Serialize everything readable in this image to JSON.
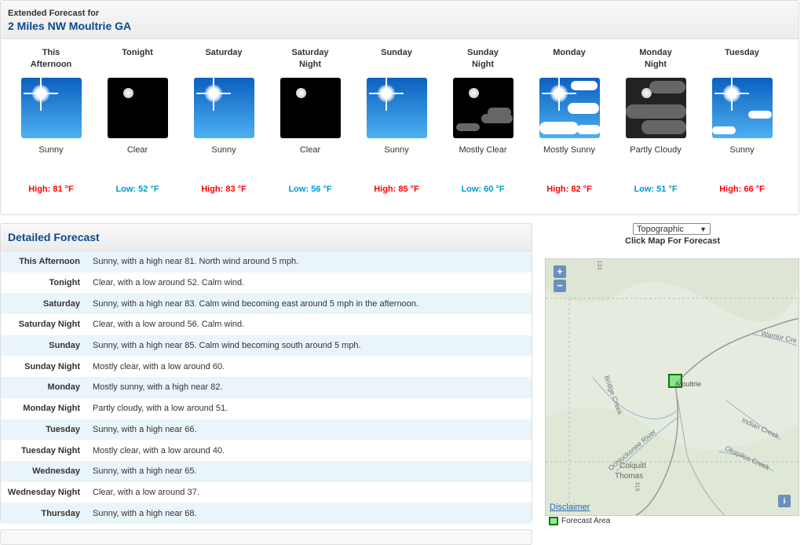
{
  "extended": {
    "label": "Extended Forecast for",
    "location": "2 Miles NW Moultrie GA",
    "periods": [
      {
        "name1": "This",
        "name2": "Afternoon",
        "icon": "sunny",
        "desc": "Sunny",
        "temp": "High: 81 °F",
        "kind": "hi"
      },
      {
        "name1": "Tonight",
        "name2": "",
        "icon": "clear-night",
        "desc": "Clear",
        "temp": "Low: 52 °F",
        "kind": "lo"
      },
      {
        "name1": "Saturday",
        "name2": "",
        "icon": "sunny",
        "desc": "Sunny",
        "temp": "High: 83 °F",
        "kind": "hi"
      },
      {
        "name1": "Saturday",
        "name2": "Night",
        "icon": "clear-night",
        "desc": "Clear",
        "temp": "Low: 56 °F",
        "kind": "lo"
      },
      {
        "name1": "Sunday",
        "name2": "",
        "icon": "sunny",
        "desc": "Sunny",
        "temp": "High: 85 °F",
        "kind": "hi"
      },
      {
        "name1": "Sunday",
        "name2": "Night",
        "icon": "mostly-clear-night",
        "desc": "Mostly Clear",
        "temp": "Low: 60 °F",
        "kind": "lo"
      },
      {
        "name1": "Monday",
        "name2": "",
        "icon": "mostly-sunny",
        "desc": "Mostly Sunny",
        "temp": "High: 82 °F",
        "kind": "hi"
      },
      {
        "name1": "Monday",
        "name2": "Night",
        "icon": "partly-cloudy-night",
        "desc": "Partly Cloudy",
        "temp": "Low: 51 °F",
        "kind": "lo"
      },
      {
        "name1": "Tuesday",
        "name2": "",
        "icon": "sunny-few-clouds",
        "desc": "Sunny",
        "temp": "High: 66 °F",
        "kind": "hi"
      }
    ],
    "colors": {
      "high": "#ff0000",
      "low": "#0099cc",
      "title": "#0a4b8c"
    }
  },
  "detailed": {
    "title": "Detailed Forecast",
    "rows": [
      {
        "label": "This Afternoon",
        "text": "Sunny, with a high near 81. North wind around 5 mph."
      },
      {
        "label": "Tonight",
        "text": "Clear, with a low around 52. Calm wind."
      },
      {
        "label": "Saturday",
        "text": "Sunny, with a high near 83. Calm wind becoming east around 5 mph in the afternoon."
      },
      {
        "label": "Saturday Night",
        "text": "Clear, with a low around 56. Calm wind."
      },
      {
        "label": "Sunday",
        "text": "Sunny, with a high near 85. Calm wind becoming south around 5 mph."
      },
      {
        "label": "Sunday Night",
        "text": "Mostly clear, with a low around 60."
      },
      {
        "label": "Monday",
        "text": "Mostly sunny, with a high near 82."
      },
      {
        "label": "Monday Night",
        "text": "Partly cloudy, with a low around 51."
      },
      {
        "label": "Tuesday",
        "text": "Sunny, with a high near 66."
      },
      {
        "label": "Tuesday Night",
        "text": "Mostly clear, with a low around 40."
      },
      {
        "label": "Wednesday",
        "text": "Sunny, with a high near 65."
      },
      {
        "label": "Wednesday Night",
        "text": "Clear, with a low around 37."
      },
      {
        "label": "Thursday",
        "text": "Sunny, with a high near 68."
      }
    ]
  },
  "map": {
    "select_value": "Topographic",
    "click_label": "Click Map For Forecast",
    "zoom_in": "+",
    "zoom_out": "−",
    "disclaimer": "Disclaimer",
    "info": "i",
    "legend": "Forecast Area",
    "labels": {
      "moultrie": "Moultrie",
      "warrior": "Warrior Cre",
      "bridge": "Bridge Creek",
      "indian": "Indian Creek",
      "ochlock": "Ochlockonee River",
      "okapilco": "Okapilco Creek",
      "colquitt": "Colquitt",
      "thomas": "Thomas",
      "route133": "133",
      "route319": "319"
    }
  }
}
